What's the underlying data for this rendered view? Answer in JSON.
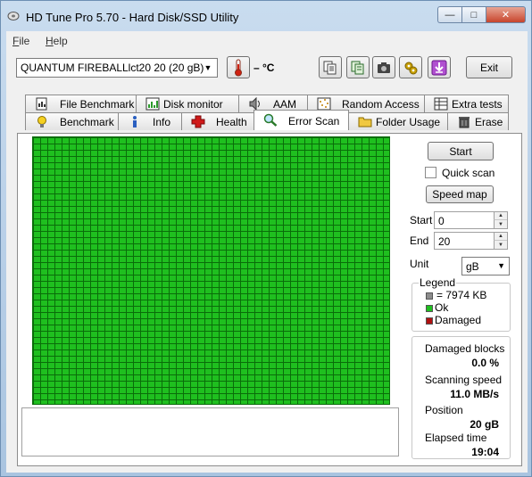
{
  "window": {
    "title": "HD Tune Pro 5.70 - Hard Disk/SSD Utility",
    "controls": {
      "minimize": "—",
      "maximize": "□",
      "close": "✕"
    }
  },
  "menu": {
    "file_underlined": "F",
    "file_rest": "ile",
    "help_underlined": "H",
    "help_rest": "elp"
  },
  "toolbar": {
    "drive": "QUANTUM FIREBALLlct20 20 (20 gB)",
    "temperature": "– °C",
    "exit": "Exit",
    "icons": [
      "thermometer-icon",
      "copy-text-icon",
      "copy-all-icon",
      "camera-icon",
      "tools-icon",
      "download-icon"
    ]
  },
  "tabs": {
    "top": [
      {
        "label": "File Benchmark",
        "icon": "file-benchmark-icon"
      },
      {
        "label": "Disk monitor",
        "icon": "disk-monitor-icon"
      },
      {
        "label": "AAM",
        "icon": "speaker-icon"
      },
      {
        "label": "Random Access",
        "icon": "random-access-icon"
      },
      {
        "label": "Extra tests",
        "icon": "extra-tests-icon"
      }
    ],
    "bottom": [
      {
        "label": "Benchmark",
        "icon": "lightbulb-icon"
      },
      {
        "label": "Info",
        "icon": "info-icon"
      },
      {
        "label": "Health",
        "icon": "health-cross-icon"
      },
      {
        "label": "Error Scan",
        "icon": "magnifier-icon",
        "active": true
      },
      {
        "label": "Folder Usage",
        "icon": "folder-icon"
      },
      {
        "label": "Erase",
        "icon": "trash-icon"
      }
    ]
  },
  "controls": {
    "start_button": "Start",
    "quick_scan_label": "Quick scan",
    "quick_scan_checked": false,
    "speed_map_button": "Speed map",
    "start_label": "Start",
    "start_value": "0",
    "end_label": "End",
    "end_value": "20",
    "unit_label": "Unit",
    "unit_value": "gB"
  },
  "legend": {
    "title": "Legend",
    "block_size": "= 7974 KB",
    "ok": "Ok",
    "damaged": "Damaged",
    "colors": {
      "block": "#8c8c8c",
      "ok": "#1fbf1f",
      "damaged": "#b01010"
    }
  },
  "stats": {
    "damaged_label": "Damaged blocks",
    "damaged_value": "0.0 %",
    "speed_label": "Scanning speed",
    "speed_value": "11.0 MB/s",
    "position_label": "Position",
    "position_value": "20 gB",
    "elapsed_label": "Elapsed time",
    "elapsed_value": "19:04"
  },
  "scan_grid": {
    "status": "ok",
    "ok_color": "#1fbf1f",
    "grid_color": "#0a6d0a"
  }
}
